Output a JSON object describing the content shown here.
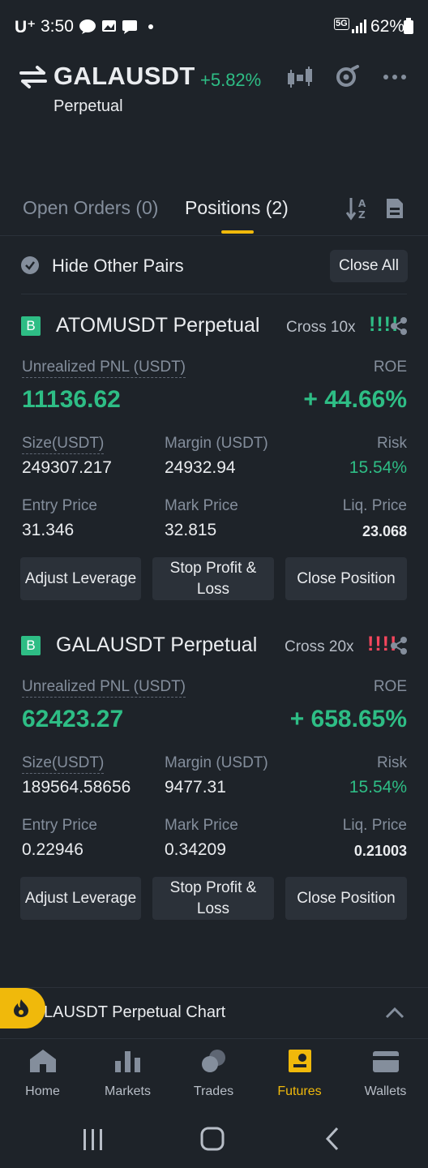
{
  "status_bar": {
    "carrier": "U⁺",
    "time": "3:50",
    "network": "5G",
    "battery": "62%"
  },
  "header": {
    "symbol": "GALAUSDT",
    "change": "+5.82%",
    "subtitle": "Perpetual"
  },
  "tabs": [
    {
      "label": "Open Orders (0)"
    },
    {
      "label": "Positions (2)"
    }
  ],
  "filters": {
    "hide_other_pairs": "Hide Other Pairs",
    "close_all": "Close All"
  },
  "positions": [
    {
      "side_badge": "B",
      "symbol": "ATOMUSDT Perpetual",
      "margin_mode": "Cross 10x",
      "risk_bars": "!!!!",
      "risk_color": "#2ebd85",
      "pnl_label": "Unrealized PNL (USDT)",
      "pnl": "11136.62",
      "roe_label": "ROE",
      "roe": "+ 44.66%",
      "size_label": "Size(USDT)",
      "size": "249307.217",
      "margin_label": "Margin (USDT)",
      "margin": "24932.94",
      "risk_label": "Risk",
      "risk": "15.54%",
      "entry_label": "Entry Price",
      "entry": "31.346",
      "mark_label": "Mark Price",
      "mark": "32.815",
      "liq_label": "Liq. Price",
      "liq": "23.068",
      "btn_leverage": "Adjust Leverage",
      "btn_tpsl": "Stop Profit & Loss",
      "btn_close": "Close Position"
    },
    {
      "side_badge": "B",
      "symbol": "GALAUSDT Perpetual",
      "margin_mode": "Cross 20x",
      "risk_bars": "!!!!",
      "risk_color": "#f6465d",
      "pnl_label": "Unrealized PNL (USDT)",
      "pnl": "62423.27",
      "roe_label": "ROE",
      "roe": "+ 658.65%",
      "size_label": "Size(USDT)",
      "size": "189564.58656",
      "margin_label": "Margin (USDT)",
      "margin": "9477.31",
      "risk_label": "Risk",
      "risk": "15.54%",
      "entry_label": "Entry Price",
      "entry": "0.22946",
      "mark_label": "Mark Price",
      "mark": "0.34209",
      "liq_label": "Liq. Price",
      "liq": "0.21003",
      "btn_leverage": "Adjust Leverage",
      "btn_tpsl": "Stop Profit & Loss",
      "btn_close": "Close Position"
    }
  ],
  "chart_bar": {
    "label": "LAUSDT Perpetual  Chart"
  },
  "bottom_nav": [
    {
      "label": "Home",
      "icon": "home-icon"
    },
    {
      "label": "Markets",
      "icon": "markets-icon"
    },
    {
      "label": "Trades",
      "icon": "trades-icon"
    },
    {
      "label": "Futures",
      "icon": "futures-icon"
    },
    {
      "label": "Wallets",
      "icon": "wallet-icon"
    }
  ],
  "colors": {
    "background": "#1e2329",
    "accent": "#f0b90b",
    "positive": "#2ebd85",
    "negative": "#f6465d"
  }
}
